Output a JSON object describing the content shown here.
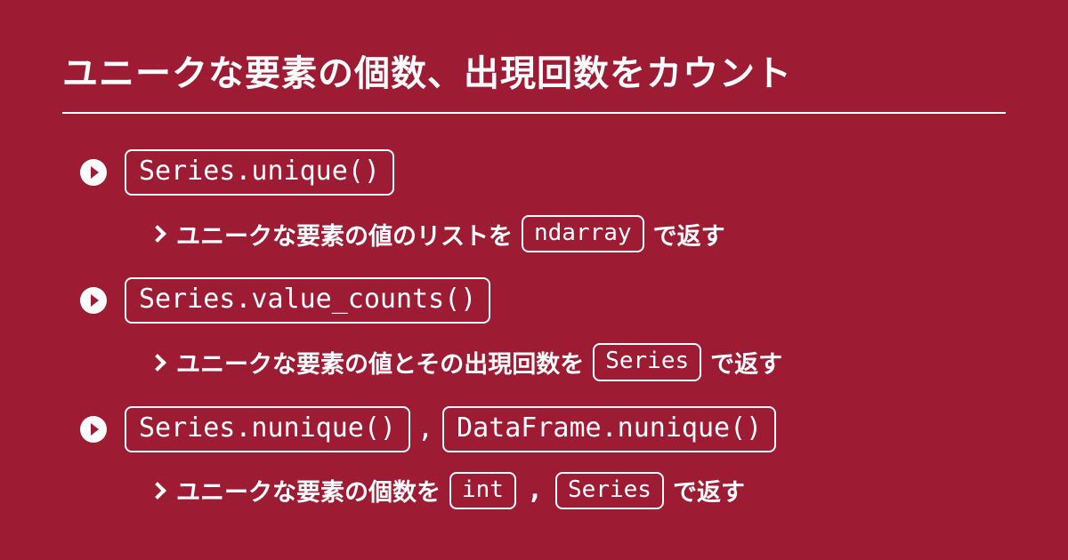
{
  "title": "ユニークな要素の個数、出現回数をカウント",
  "items": [
    {
      "codes": [
        "Series.unique()"
      ],
      "desc_pre": "ユニークな要素の値のリストを",
      "types": [
        "ndarray"
      ],
      "desc_post": "で返す"
    },
    {
      "codes": [
        "Series.value_counts()"
      ],
      "desc_pre": "ユニークな要素の値とその出現回数を",
      "types": [
        "Series"
      ],
      "desc_post": "で返す"
    },
    {
      "codes": [
        "Series.nunique()",
        "DataFrame.nunique()"
      ],
      "desc_pre": "ユニークな要素の個数を",
      "types": [
        "int",
        "Series"
      ],
      "desc_post": "で返す"
    }
  ],
  "comma": ","
}
